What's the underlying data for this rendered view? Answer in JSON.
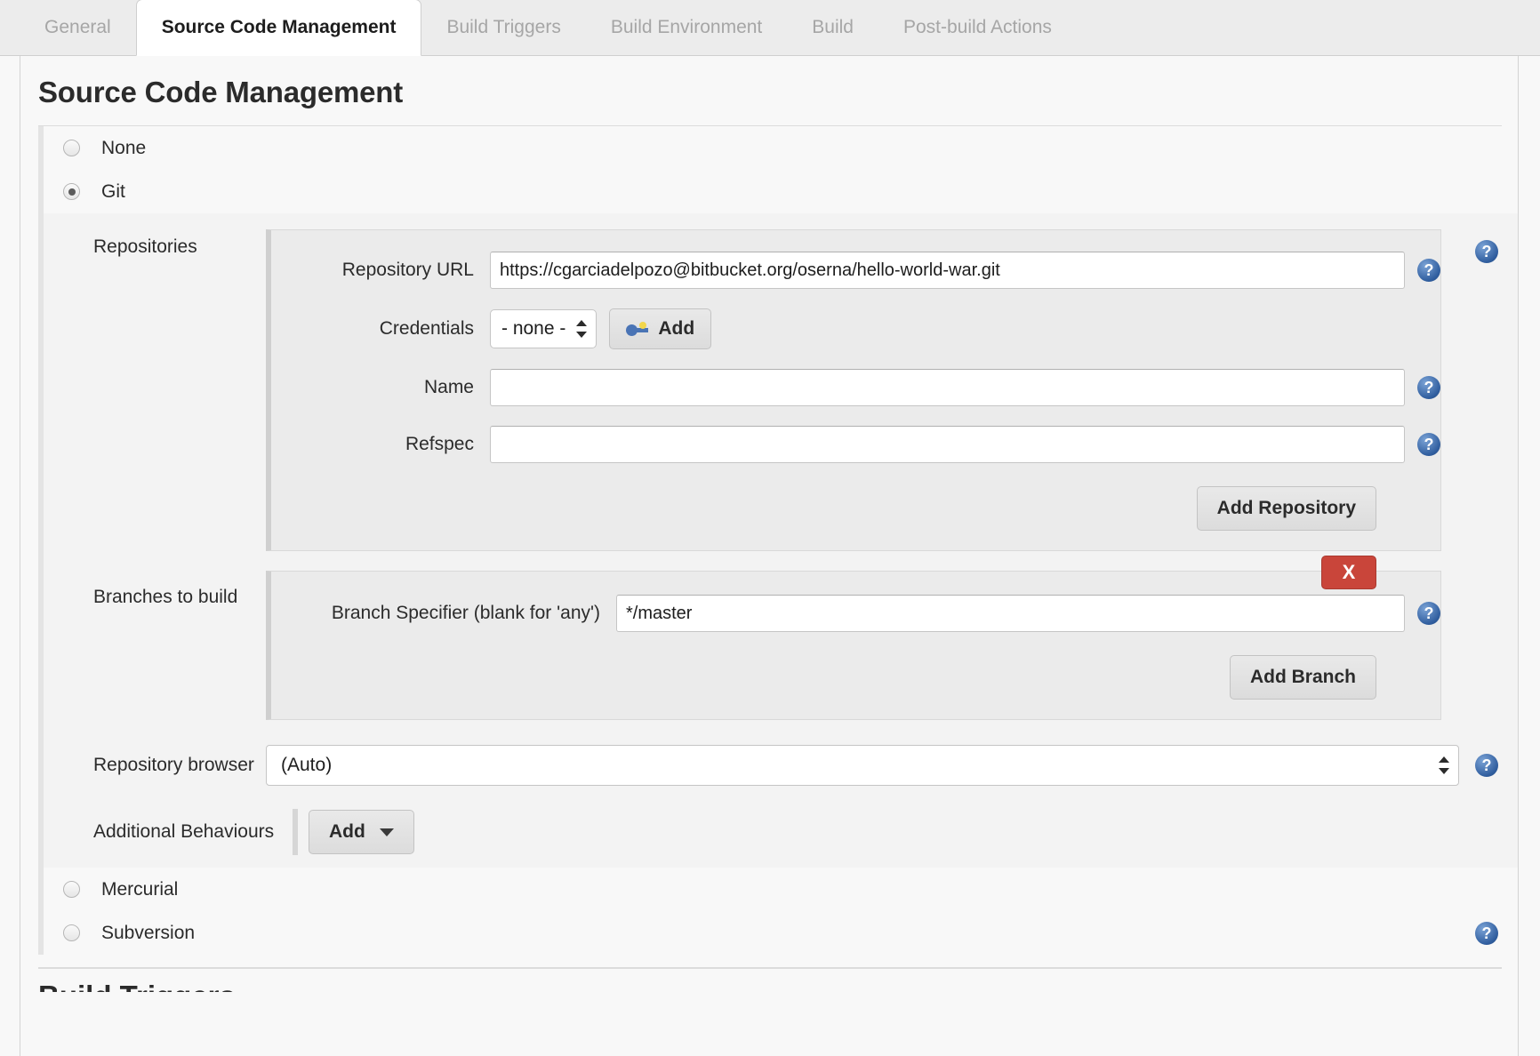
{
  "tabs": [
    {
      "label": "General",
      "active": false
    },
    {
      "label": "Source Code Management",
      "active": true
    },
    {
      "label": "Build Triggers",
      "active": false
    },
    {
      "label": "Build Environment",
      "active": false
    },
    {
      "label": "Build",
      "active": false
    },
    {
      "label": "Post-build Actions",
      "active": false
    }
  ],
  "page": {
    "title": "Source Code Management",
    "next_section_title": "Build Triggers"
  },
  "scm": {
    "options": [
      {
        "label": "None",
        "selected": false
      },
      {
        "label": "Git",
        "selected": true
      },
      {
        "label": "Mercurial",
        "selected": false
      },
      {
        "label": "Subversion",
        "selected": false
      }
    ]
  },
  "git": {
    "repositories": {
      "label": "Repositories",
      "repository_url": {
        "label": "Repository URL",
        "value": "https://cgarciadelpozo@bitbucket.org/oserna/hello-world-war.git"
      },
      "credentials": {
        "label": "Credentials",
        "selected": "- none -",
        "add_button": "Add"
      },
      "name": {
        "label": "Name",
        "value": ""
      },
      "refspec": {
        "label": "Refspec",
        "value": ""
      },
      "add_repository_button": "Add Repository"
    },
    "branches": {
      "label": "Branches to build",
      "delete_button": "X",
      "branch_specifier": {
        "label": "Branch Specifier (blank for 'any')",
        "value": "*/master"
      },
      "add_branch_button": "Add Branch"
    },
    "repository_browser": {
      "label": "Repository browser",
      "selected": "(Auto)"
    },
    "additional_behaviours": {
      "label": "Additional Behaviours",
      "add_button": "Add"
    }
  },
  "icons": {
    "help": "?",
    "help_name": "help-icon",
    "key": "key-icon",
    "caret": "chevron-down-icon"
  },
  "colors": {
    "accent_blue": "#2f5d9e",
    "danger_red": "#c9453a",
    "panel_grey": "#ebebeb",
    "page_bg": "#f8f8f8"
  }
}
